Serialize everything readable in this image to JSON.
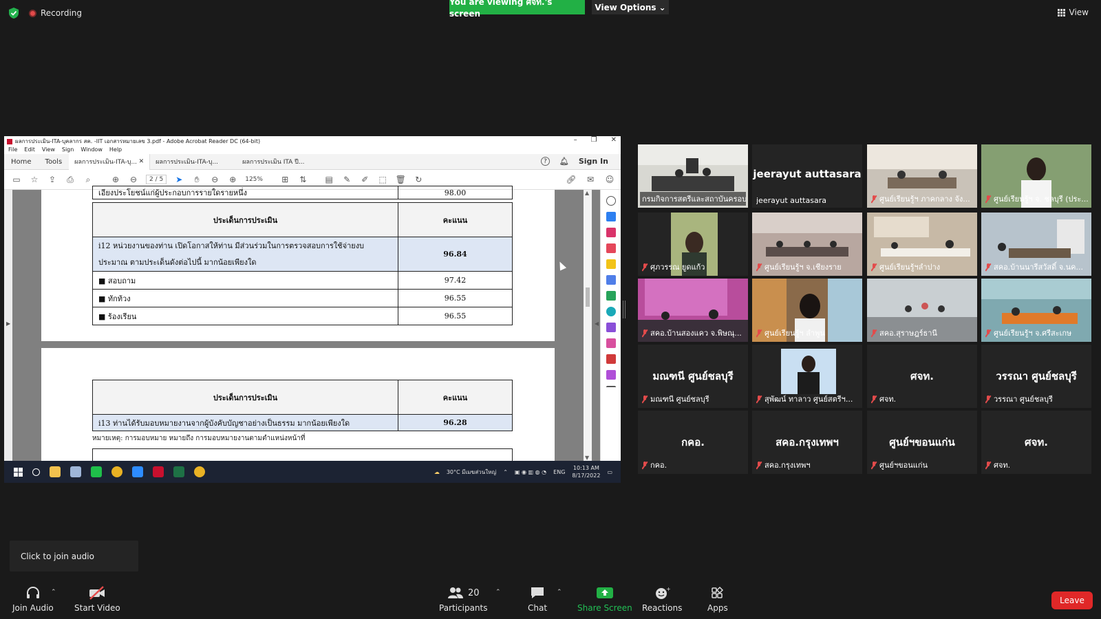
{
  "top": {
    "recording_label": "Recording",
    "viewing_banner": "You are viewing ศจท.'s screen",
    "view_options_label": "View Options",
    "view_label": "View"
  },
  "shared": {
    "window_title": "ผลการประเมิน-ITA-บุคลากร สค. -IIT เอกสารหมายเลข 3.pdf - Adobe Acrobat Reader DC (64-bit)",
    "menu": [
      "File",
      "Edit",
      "View",
      "Sign",
      "Window",
      "Help"
    ],
    "tabs": {
      "home": "Home",
      "tools": "Tools",
      "doc1": "ผลการประเมิน-ITA-บุ...",
      "doc2": "ผลการประเมิน-ITA-บุ...",
      "doc3": "ผลการประเมิน ITA ปี..."
    },
    "sign_in": "Sign In",
    "page_indicator": "2 / 5",
    "zoom_value": "125%",
    "cut_top_row": {
      "label": "เอียงประโยชน์แก่ผู้ประกอบการรายใดรายหนึ่ง",
      "score": "98.00"
    },
    "table1": {
      "header_topic": "ประเด็นการประเมิน",
      "header_score": "คะแนน",
      "question": "i12 หน่วยงานของท่าน เปิดโอกาสให้ท่าน มีส่วนร่วมในการตรวจสอบการใช้จ่ายงบประมาณ ตามประเด็นดังต่อไปนี้ มากน้อยเพียงใด",
      "question_score": "96.84",
      "rows": [
        {
          "label": "สอบถาม",
          "score": "97.42"
        },
        {
          "label": "ทักท้วง",
          "score": "96.55"
        },
        {
          "label": "ร้องเรียน",
          "score": "96.55"
        }
      ]
    },
    "table2": {
      "header_topic": "ประเด็นการประเมิน",
      "header_score": "คะแนน",
      "question": "i13 ท่านได้รับมอบหมายงานจากผู้บังคับบัญชาอย่างเป็นธรรม มากน้อยเพียงใด",
      "question_score": "96.28",
      "note": "หมายเหตุ: การมอบหมาย หมายถึง การมอบหมายงานตามตำแหน่งหน้าที่"
    },
    "taskbar": {
      "weather": "30°C มีเมฆส่วนใหญ่",
      "lang": "ENG",
      "time": "10:13 AM",
      "date": "8/17/2022"
    }
  },
  "participants_grid": [
    {
      "name": "กรมกิจการสตรีและสถาบันครอบครัว",
      "type": "video",
      "active": true,
      "mic_muted": false
    },
    {
      "name": "jeerayut auttasara",
      "big": "jeerayut auttasara",
      "type": "name",
      "mic_muted": false
    },
    {
      "name": "ศูนย์เรียนรู้ฯ ภาคกลาง จัง...",
      "type": "video",
      "mic_muted": true
    },
    {
      "name": "ศูนย์เรียนรู้ฯ จ. ชลบุรี (ประ...",
      "type": "video",
      "mic_muted": true
    },
    {
      "name": "ศุภวรรณ ยูดแก้ว",
      "type": "video",
      "mic_muted": true
    },
    {
      "name": "ศูนย์เรียนรู้ฯ จ.เชียงราย",
      "type": "video",
      "mic_muted": true
    },
    {
      "name": "ศูนย์เรียนรู้ฯลำปาง",
      "type": "video",
      "mic_muted": true
    },
    {
      "name": "สคอ.บ้านนารีสวัสดิ์ จ.นค...",
      "type": "video",
      "mic_muted": true
    },
    {
      "name": "สคอ.บ้านสองแคว จ.พิษณุ...",
      "type": "video",
      "mic_muted": true
    },
    {
      "name": "ศูนย์เรียนรู้ฯ ลำพูน",
      "type": "video",
      "mic_muted": true
    },
    {
      "name": "สคอ.สุราษฎร์ธานี",
      "type": "video",
      "mic_muted": true
    },
    {
      "name": "ศูนย์เรียนรู้ฯ จ.ศรีสะเกษ",
      "type": "video",
      "mic_muted": true
    },
    {
      "name": "มณฑนี ศูนย์ชลบุรี",
      "big": "มณฑนี ศูนย์ชลบุรี",
      "type": "name",
      "mic_muted": true
    },
    {
      "name": "สุพัฒน์ ทาลาว ศูนย์สตรีฯ...",
      "type": "video",
      "mic_muted": true
    },
    {
      "name": "ศจท.",
      "big": "ศจท.",
      "type": "name",
      "mic_muted": true
    },
    {
      "name": "วรรณา ศูนย์ชลบุรี",
      "big": "วรรณา ศูนย์ชลบุรี",
      "type": "name",
      "mic_muted": true
    },
    {
      "name": "กคอ.",
      "big": "กคอ.",
      "type": "name",
      "mic_muted": true
    },
    {
      "name": "สคอ.กรุงเทพฯ",
      "big": "สคอ.กรุงเทพฯ",
      "type": "name",
      "mic_muted": true
    },
    {
      "name": "ศูนย์ฯขอนแก่น",
      "big": "ศูนย์ฯขอนแก่น",
      "type": "name",
      "mic_muted": true
    },
    {
      "name": "ศจท.",
      "big": "ศจท.",
      "type": "name",
      "mic_muted": true
    }
  ],
  "bottom": {
    "join_audio_popup": "Click to join audio",
    "join_audio": "Join Audio",
    "start_video": "Start Video",
    "participants": "Participants",
    "participants_count": "20",
    "chat": "Chat",
    "share_screen": "Share Screen",
    "reactions": "Reactions",
    "apps": "Apps",
    "leave": "Leave"
  },
  "colors": {
    "share_green": "#22b045",
    "leave_red": "#e02828",
    "active_speaker": "#c5d83b",
    "mic_muted_red": "#e34b4b"
  }
}
